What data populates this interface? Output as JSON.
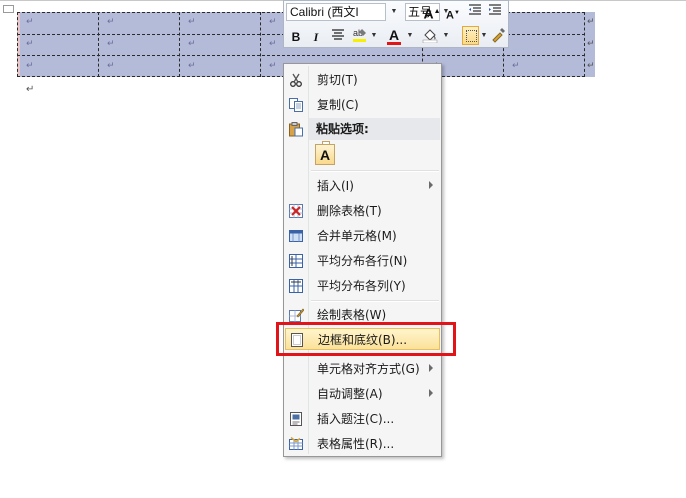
{
  "document": {
    "cell_mark": "↵",
    "paragraph_mark": "↵"
  },
  "mini_toolbar": {
    "font_name": "Calibri (西文I",
    "font_size": "五号",
    "buttons": [
      "bold",
      "italic",
      "center",
      "highlight",
      "font-color",
      "shading",
      "borders",
      "format-painter"
    ],
    "grow_font": "A",
    "shrink_font": "A",
    "bold": "B",
    "italic": "I",
    "font_color_letter": "A"
  },
  "context_menu": {
    "items": [
      {
        "label": "剪切(T)",
        "icon": "scissors-icon"
      },
      {
        "label": "复制(C)",
        "icon": "copy-icon"
      },
      {
        "label": "粘贴选项:",
        "icon": "paste-icon"
      },
      {
        "label": "插入(I)",
        "icon": "",
        "submenu": true
      },
      {
        "label": "删除表格(T)",
        "icon": "delete-table-icon"
      },
      {
        "label": "合并单元格(M)",
        "icon": "merge-cells-icon"
      },
      {
        "label": "平均分布各行(N)",
        "icon": "distribute-rows-icon"
      },
      {
        "label": "平均分布各列(Y)",
        "icon": "distribute-columns-icon"
      },
      {
        "label": "绘制表格(W)",
        "icon": "draw-table-icon"
      },
      {
        "label": "边框和底纹(B)...",
        "icon": "borders-shading-icon",
        "highlighted": true
      },
      {
        "label": "单元格对齐方式(G)",
        "icon": "",
        "submenu": true
      },
      {
        "label": "自动调整(A)",
        "icon": "",
        "submenu": true
      },
      {
        "label": "插入题注(C)...",
        "icon": "caption-icon"
      },
      {
        "label": "表格属性(R)...",
        "icon": "table-properties-icon"
      }
    ],
    "paste_option_letter": "A"
  },
  "colors": {
    "selection": "#b4bbd9",
    "menu_hover": "#fbe29a",
    "annotation_box": "#e1141a"
  }
}
